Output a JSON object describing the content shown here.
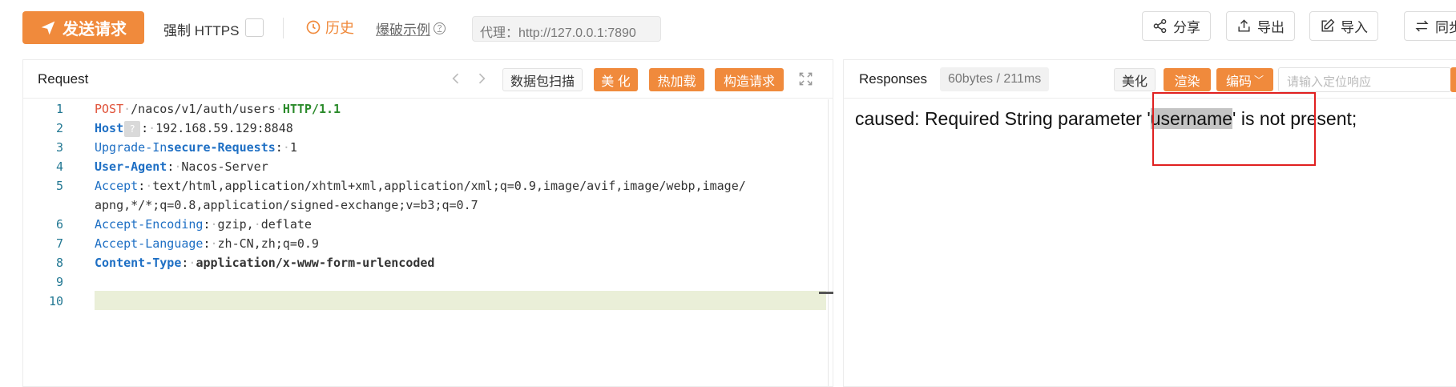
{
  "toolbar": {
    "send_label": "发送请求",
    "https_label": "强制 HTTPS",
    "https_checked": false,
    "history_label": "历史",
    "explode_label": "爆破示例",
    "proxy_text": "代理：http://127.0.0.1:7890",
    "share_label": "分享",
    "export_label": "导出",
    "import_label": "导入",
    "sync_label": "同步"
  },
  "request": {
    "title": "Request",
    "packet_scan_label": "数据包扫描",
    "beautify_label": "美 化",
    "hot_load_label": "热加载",
    "build_label": "构造请求",
    "line_numbers": [
      "1",
      "2",
      "3",
      "4",
      "5",
      "",
      "6",
      "7",
      "8",
      "9",
      "10"
    ],
    "lines": {
      "method": "POST",
      "path": "/nacos/v1/auth/users",
      "proto": "HTTP/1.1",
      "host_key": "Host",
      "host_qmark": "?",
      "host_value": "192.168.59.129:8848",
      "upgrade_key_a": "Upgrade-In",
      "upgrade_key_b": "secure-Requests",
      "upgrade_value": "1",
      "ua_key": "User-Agent",
      "ua_value": "Nacos-Server",
      "accept_key": "Accept",
      "accept_value_1": "text/html,application/xhtml+xml,application/xml;q=0.9,image/avif,image/webp,image/",
      "accept_value_2": "apng,*/*;q=0.8,application/signed-exchange;v=b3;q=0.7",
      "encoding_key": "Accept-Encoding",
      "encoding_value_a": "gzip,",
      "encoding_value_b": "deflate",
      "language_key": "Accept-Language",
      "language_value": "zh-CN,zh;q=0.9",
      "ctype_key": "Content-Type",
      "ctype_value": "application/x-www-form-urlencoded"
    }
  },
  "response": {
    "title": "Responses",
    "stats": "60bytes / 211ms",
    "beautify_label": "美化",
    "render_label": "渲染",
    "encode_label": "编码",
    "locate_placeholder": "请输入定位响应",
    "body_before": "caused: Required String parameter '",
    "body_highlight": "username",
    "body_after": "' is not present;"
  },
  "colors": {
    "accent": "#f08a3c",
    "annotation_box": "#e02020",
    "current_line": "#eaefd8"
  }
}
